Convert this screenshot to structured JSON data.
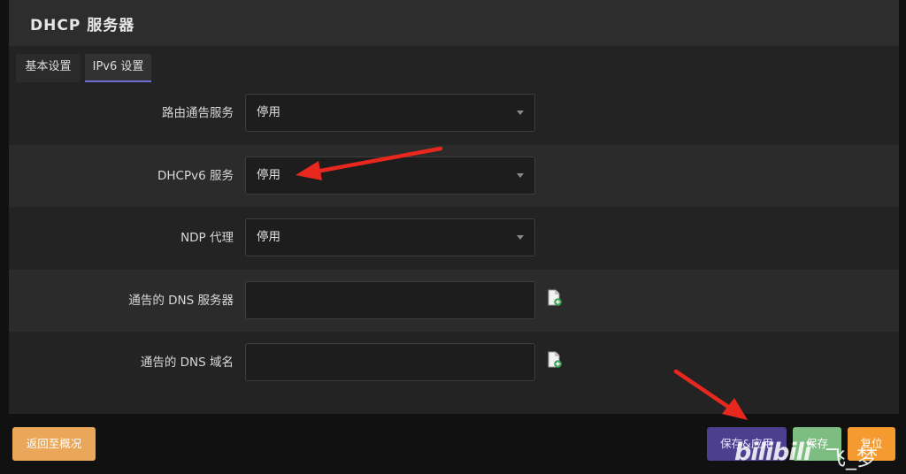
{
  "header": {
    "title": "DHCP 服务器"
  },
  "tabs": [
    {
      "label": "基本设置"
    },
    {
      "label": "IPv6 设置"
    }
  ],
  "fields": {
    "ra_service": {
      "label": "路由通告服务",
      "value": "停用"
    },
    "dhcpv6_service": {
      "label": "DHCPv6 服务",
      "value": "停用"
    },
    "ndp_proxy": {
      "label": "NDP 代理",
      "value": "停用"
    },
    "dns_servers": {
      "label": "通告的 DNS 服务器",
      "value": ""
    },
    "dns_domains": {
      "label": "通告的 DNS 域名",
      "value": ""
    }
  },
  "buttons": {
    "back": "返回至概况",
    "save_apply": "保存&应用",
    "save": "保存",
    "reset": "复位"
  },
  "watermark": {
    "brand": "bilibili",
    "user": "飞_梦"
  },
  "colors": {
    "annotation_arrow": "#e8281e",
    "accent_tab": "#6c6fd0",
    "save_apply": "#4b3f8e",
    "save": "#7dbd82",
    "reset": "#f59a2f",
    "back": "#eaa75a"
  },
  "icons": {
    "add_entry": "document-plus-icon",
    "dropdown": "caret-down-icon"
  }
}
